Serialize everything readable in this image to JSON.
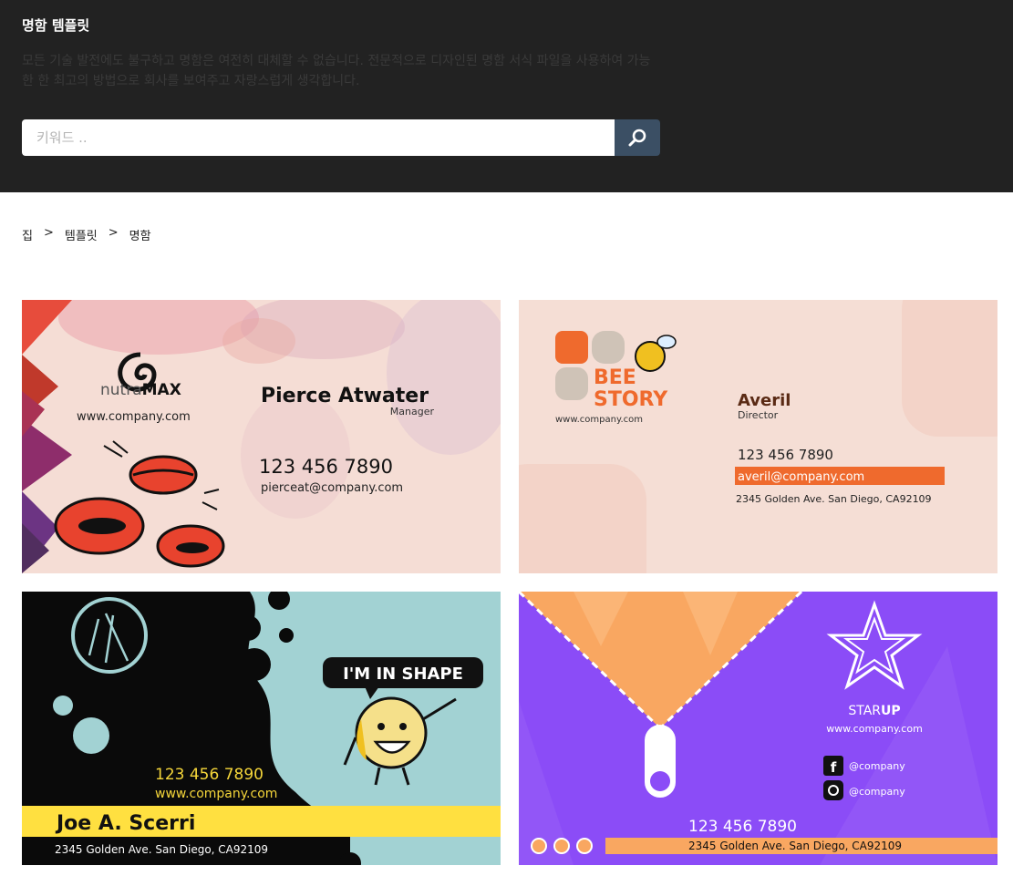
{
  "hero": {
    "title": "명함 템플릿",
    "description": "모든 기술 발전에도 불구하고 명함은 여전히 대체할 수 없습니다. 전문적으로 디자인된 명함 서식 파일을 사용하여 가능한 한 최고의 방법으로 회사를 보여주고 자랑스럽게 생각합니다."
  },
  "search": {
    "placeholder": "키워드 .."
  },
  "breadcrumb": {
    "home": "집",
    "templates": "템플릿",
    "current": "명함",
    "separator": ">"
  },
  "colors": {
    "hero_bg": "#222222",
    "search_button": "#3b4f64"
  },
  "cards": [
    {
      "brand_pre": "nutra",
      "brand_bold": "MAX",
      "website": "www.company.com",
      "name": "Pierce Atwater",
      "role": "Manager",
      "phone": "123 456 7890",
      "email": "pierceat@company.com"
    },
    {
      "brand_line1": "BEE",
      "brand_line2": "STORY",
      "website": "www.company.com",
      "name": "Averil",
      "role": "Director",
      "phone": "123 456 7890",
      "email": "averil@company.com",
      "address": "2345 Golden Ave. San Diego, CA92109"
    },
    {
      "bubble": "I'M IN SHAPE",
      "phone": "123 456 7890",
      "website": "www.company.com",
      "name": "Joe A. Scerri",
      "address": "2345 Golden Ave. San Diego, CA92109"
    },
    {
      "brand_pre": "STAR",
      "brand_bold": "UP",
      "website": "www.company.com",
      "facebook": "@company",
      "instagram": "@company",
      "phone": "123 456 7890",
      "address": "2345 Golden Ave. San Diego, CA92109"
    }
  ]
}
